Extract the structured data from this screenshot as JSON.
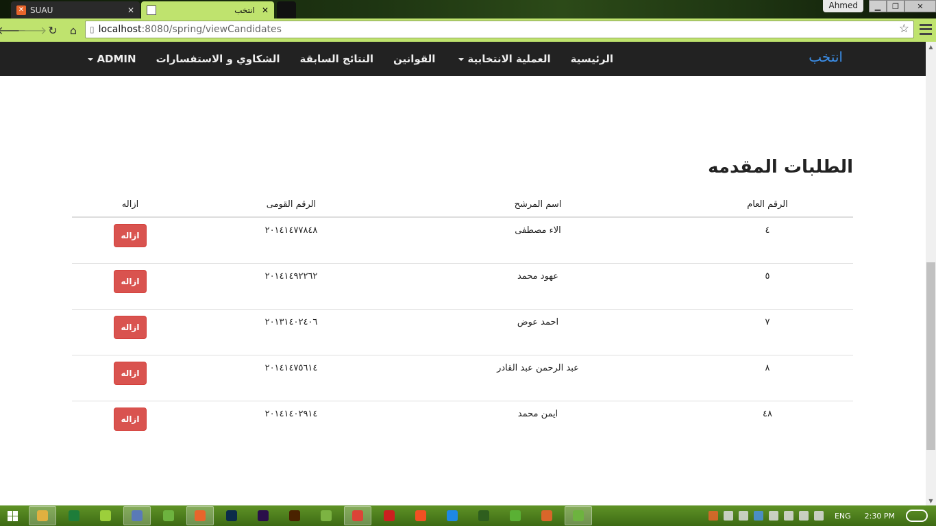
{
  "browser": {
    "tabs": [
      {
        "title": "SUAU",
        "active": false
      },
      {
        "title": "انتخب",
        "active": true
      }
    ],
    "user": "Ahmed",
    "url": {
      "host": "localhost",
      "path": ":8080/spring/viewCandidates"
    }
  },
  "navbar": {
    "brand": "انتخب",
    "links": [
      {
        "label": "الرئيسية",
        "dropdown": false
      },
      {
        "label": "العملية الانتخابية",
        "dropdown": true
      },
      {
        "label": "القوانين",
        "dropdown": false
      },
      {
        "label": "النتائج السابقة",
        "dropdown": false
      },
      {
        "label": "الشكاوي و الاستفسارات",
        "dropdown": false
      },
      {
        "label": "ADMIN",
        "dropdown": true
      }
    ]
  },
  "page": {
    "title": "الطلبات المقدمه",
    "columns": [
      "الرقم العام",
      "اسم المرشح",
      "الرقم القومى",
      "ازاله"
    ],
    "delete_label": "ازاله",
    "rows": [
      {
        "id": "٤",
        "name": "الاء مصطفى",
        "national_id": "٢٠١٤١٤٧٧٨٤٨"
      },
      {
        "id": "٥",
        "name": "عهود محمد",
        "national_id": "٢٠١٤١٤٩٢٢٦٢"
      },
      {
        "id": "٧",
        "name": "احمد عوض",
        "national_id": "٢٠١٣١٤٠٢٤٠٦"
      },
      {
        "id": "٨",
        "name": "عبد الرحمن عبد القادر",
        "national_id": "٢٠١٤١٤٧٥٦١٤"
      },
      {
        "id": "٤٨",
        "name": "ايمن محمد",
        "national_id": "٢٠١٤١٤٠٢٩١٤"
      }
    ]
  },
  "taskbar": {
    "language": "ENG",
    "time": "2:30 PM",
    "apps": [
      {
        "icon": "file-explorer-icon",
        "color": "#e0b040",
        "active": true
      },
      {
        "icon": "excel-icon",
        "color": "#1e7d3a",
        "active": false
      },
      {
        "icon": "folder-icon",
        "color": "#9ccf3b",
        "active": false
      },
      {
        "icon": "virtualbox-icon",
        "color": "#5a7ab8",
        "active": true
      },
      {
        "icon": "spring-icon",
        "color": "#6db33f",
        "active": false
      },
      {
        "icon": "xampp-icon",
        "color": "#e8652b",
        "active": true
      },
      {
        "icon": "photoshop-icon",
        "color": "#0b2c4a",
        "active": false
      },
      {
        "icon": "after-effects-icon",
        "color": "#2a0e4a",
        "active": false
      },
      {
        "icon": "illustrator-icon",
        "color": "#4a2200",
        "active": false
      },
      {
        "icon": "android-icon",
        "color": "#7cb342",
        "active": false
      },
      {
        "icon": "chrome-icon",
        "color": "#db4437",
        "active": true
      },
      {
        "icon": "opera-icon",
        "color": "#cc1f1f",
        "active": false
      },
      {
        "icon": "office-icon",
        "color": "#f25022",
        "active": false
      },
      {
        "icon": "messenger-icon",
        "color": "#1e88e5",
        "active": false
      },
      {
        "icon": "solitaire-icon",
        "color": "#2e5e1e",
        "active": false
      },
      {
        "icon": "utorrent-icon",
        "color": "#5ab034",
        "active": false
      },
      {
        "icon": "matlab-icon",
        "color": "#d9662a",
        "active": false
      },
      {
        "icon": "spring-tool-icon",
        "color": "#6db33f",
        "active": true
      }
    ]
  }
}
